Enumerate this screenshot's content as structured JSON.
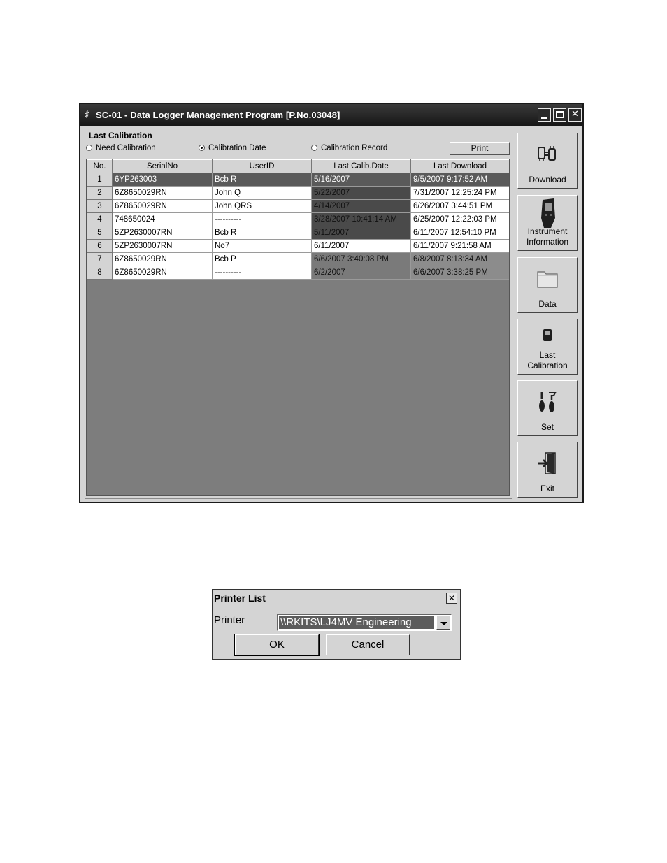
{
  "window": {
    "title": "SC-01 - Data Logger Management Program [P.No.03048]"
  },
  "last_calibration": {
    "group_label": "Last Calibration",
    "options": [
      {
        "label": "Need Calibration",
        "selected": false
      },
      {
        "label": "Calibration Date",
        "selected": true
      },
      {
        "label": "Calibration Record",
        "selected": false
      }
    ],
    "print_label": "Print",
    "columns": [
      "No.",
      "SerialNo",
      "UserID",
      "Last Calib.Date",
      "Last Download"
    ],
    "rows": [
      {
        "no": "1",
        "serial": "6YP263003",
        "user": "Bcb R",
        "calib": "5/16/2007",
        "download": "9/5/2007 9:17:52 AM"
      },
      {
        "no": "2",
        "serial": "6Z8650029RN",
        "user": "John Q",
        "calib": "5/22/2007",
        "download": "7/31/2007 12:25:24 PM"
      },
      {
        "no": "3",
        "serial": "6Z8650029RN",
        "user": "John QRS",
        "calib": "4/14/2007",
        "download": "6/26/2007 3:44:51 PM"
      },
      {
        "no": "4",
        "serial": "748650024",
        "user": "----------",
        "calib": "3/28/2007 10:41:14 AM",
        "download": "6/25/2007 12:22:03 PM"
      },
      {
        "no": "5",
        "serial": "5ZP2630007RN",
        "user": "Bcb R",
        "calib": "5/11/2007",
        "download": "6/11/2007 12:54:10 PM"
      },
      {
        "no": "6",
        "serial": "5ZP2630007RN",
        "user": "No7",
        "calib": "6/11/2007",
        "download": "6/11/2007 9:21:58 AM"
      },
      {
        "no": "7",
        "serial": "6Z8650029RN",
        "user": "Bcb P",
        "calib": "6/6/2007 3:40:08 PM",
        "download": "6/8/2007 8:13:34 AM"
      },
      {
        "no": "8",
        "serial": "6Z8650029RN",
        "user": "----------",
        "calib": "6/2/2007",
        "download": "6/6/2007 3:38:25 PM"
      }
    ]
  },
  "toolbar": {
    "download": "Download",
    "instrument_line1": "Instrument",
    "instrument_line2": "Information",
    "data": "Data",
    "last_cal_line1": "Last",
    "last_cal_line2": "Calibration",
    "set": "Set",
    "exit": "Exit"
  },
  "printer_dialog": {
    "title": "Printer List",
    "printer_label": "Printer",
    "printer_value": "\\\\RKITS\\LJ4MV Engineering",
    "ok_label": "OK",
    "cancel_label": "Cancel"
  }
}
